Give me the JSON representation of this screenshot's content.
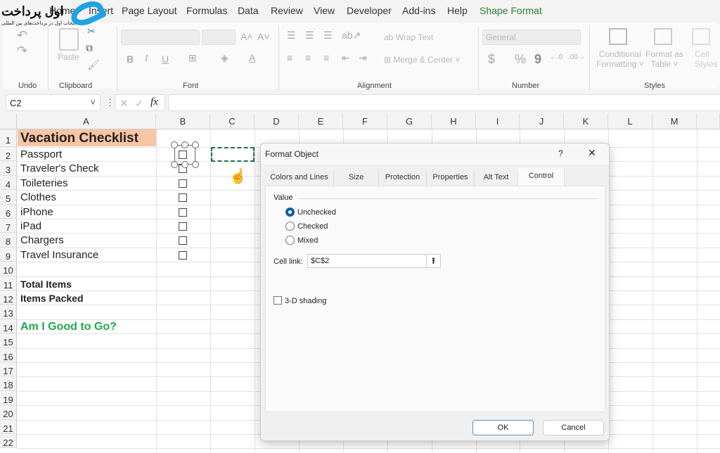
{
  "logo": {
    "text": "اول پرداخت",
    "tagline": "انتخاب اول در پرداخت‌های بین المللی",
    "brand_color": "#1fa3e6"
  },
  "menu": [
    "Home",
    "Insert",
    "Page Layout",
    "Formulas",
    "Data",
    "Review",
    "View",
    "Developer",
    "Add-ins",
    "Help",
    "Shape Format"
  ],
  "menu_accent": "#2e7d32",
  "ribbon": {
    "groups": [
      "Undo",
      "Clipboard",
      "Font",
      "Alignment",
      "Number",
      "Styles"
    ],
    "paste": "Paste",
    "wrap_text": "Wrap Text",
    "merge_center": "Merge & Center",
    "number_format": "General",
    "conditional": [
      "Conditional",
      "Formatting"
    ],
    "format_table": [
      "Format as",
      "Table"
    ],
    "cell_styles": [
      "Cell",
      "Styles"
    ],
    "bold": "B",
    "italic": "I",
    "underline": "U",
    "dollar": "$",
    "percent": "%",
    "comma": "9",
    "fx": "fx"
  },
  "formula_bar": {
    "name_box": "C2",
    "formula": ""
  },
  "columns": [
    "A",
    "B",
    "C",
    "D",
    "E",
    "F",
    "G",
    "H",
    "I",
    "J",
    "K",
    "L",
    "M"
  ],
  "rows": [
    "1",
    "2",
    "3",
    "4",
    "5",
    "6",
    "7",
    "8",
    "9",
    "10",
    "11",
    "12",
    "13",
    "14",
    "15",
    "16",
    "17",
    "18",
    "19",
    "20",
    "21",
    "22"
  ],
  "cells": {
    "title": "Vacation Checklist",
    "title_bg": "#f8c6a4",
    "items": [
      "Passport",
      "Traveler's Check",
      "Toileteries",
      "Clothes",
      "iPhone",
      "iPad",
      "Chargers",
      "Travel Insurance"
    ],
    "total": "Total Items",
    "packed": "Items Packed",
    "good": "Am I Good to Go?",
    "good_color": "#22a94a"
  },
  "dialog": {
    "title": "Format Object",
    "help": "?",
    "close": "✕",
    "tabs": [
      "Colors and Lines",
      "Size",
      "Protection",
      "Properties",
      "Alt Text",
      "Control"
    ],
    "active_tab": "Control",
    "value_label": "Value",
    "options": [
      {
        "label": "Unchecked",
        "checked": true
      },
      {
        "label": "Checked",
        "checked": false
      },
      {
        "label": "Mixed",
        "checked": false
      }
    ],
    "cell_link_label": "Cell link:",
    "cell_link_value": "$C$2",
    "shading_label": "3-D shading",
    "shading_checked": false,
    "ok": "OK",
    "cancel": "Cancel"
  }
}
